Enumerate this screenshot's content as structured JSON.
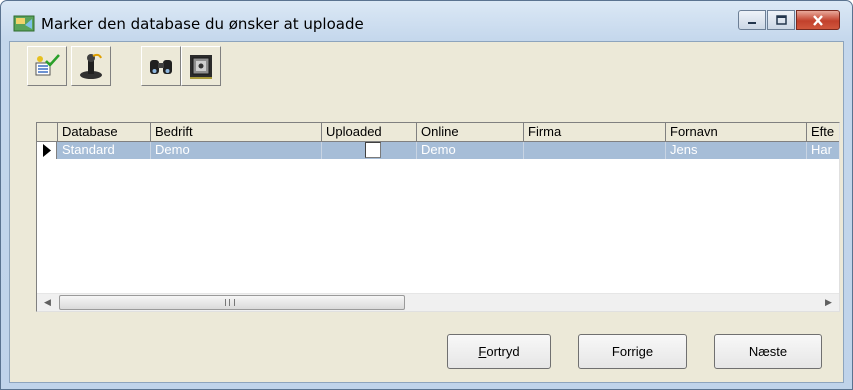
{
  "window": {
    "title": "Marker den database du ønsker at uploade",
    "minimize_icon": "minimize-icon",
    "maximize_icon": "maximize-icon",
    "close_icon": "close-icon"
  },
  "toolbar": {
    "buttons": [
      {
        "icon": "select-all-icon"
      },
      {
        "icon": "joystick-icon"
      },
      {
        "icon": "binoculars-icon"
      },
      {
        "icon": "safe-icon"
      }
    ]
  },
  "grid": {
    "columns": [
      "Database",
      "Bedrift",
      "Uploaded",
      "Online",
      "Firma",
      "Fornavn",
      "Efte"
    ],
    "rows": [
      {
        "database": "Standard",
        "bedrift": "Demo",
        "uploaded": false,
        "online": "Demo",
        "firma": "",
        "fornavn": "Jens",
        "efternavn": "Har"
      }
    ],
    "scrollbar": {
      "thumb_grip": "III"
    }
  },
  "buttons": {
    "cancel_mnemonic": "F",
    "cancel_rest": "ortryd",
    "previous": "Forrige",
    "next": "Næste"
  },
  "colors": {
    "selected_row": "#a6bdd7",
    "selected_text": "#ffffff",
    "close_button": "#c2412c"
  }
}
